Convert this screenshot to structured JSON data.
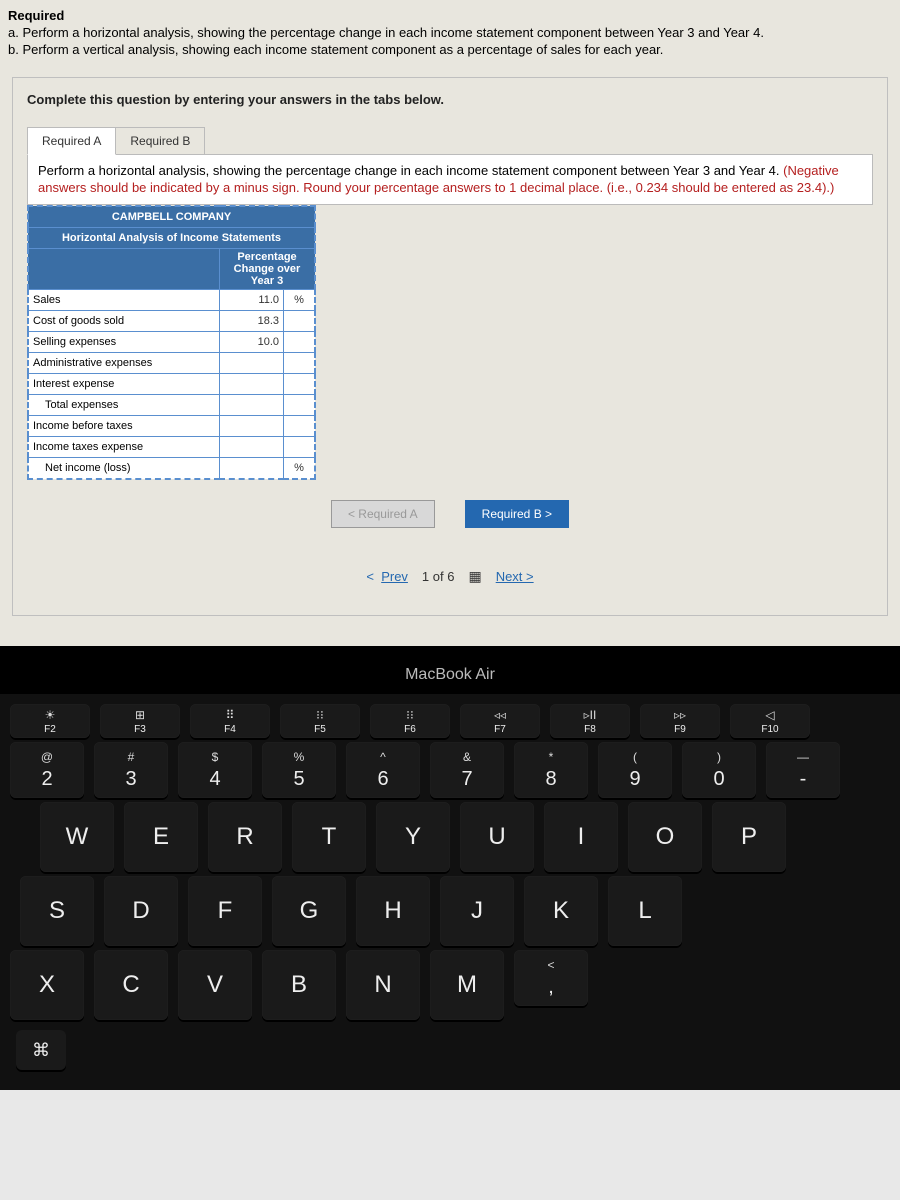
{
  "header": {
    "required_label": "Required",
    "line_a": "a. Perform a horizontal analysis, showing the percentage change in each income statement component between Year 3 and Year 4.",
    "line_b": "b. Perform a vertical analysis, showing each income statement component as a percentage of sales for each year."
  },
  "card": {
    "complete_text": "Complete this question by entering your answers in the tabs below.",
    "tabs": {
      "a": "Required A",
      "b": "Required B"
    },
    "instruction_main": "Perform a horizontal analysis, showing the percentage change in each income statement component between Year 3 and Year 4. ",
    "instruction_red": "(Negative answers should be indicated by a minus sign. Round your percentage answers to 1 decimal place. (i.e., 0.234 should be entered as 23.4).)"
  },
  "table": {
    "company": "CAMPBELL COMPANY",
    "subtitle": "Horizontal Analysis of Income Statements",
    "col_header": "Percentage Change over Year 3",
    "rows": [
      {
        "label": "Sales",
        "value": "11.0",
        "unit": "%",
        "indent": false
      },
      {
        "label": "Cost of goods sold",
        "value": "18.3",
        "unit": "",
        "indent": false
      },
      {
        "label": "Selling expenses",
        "value": "10.0",
        "unit": "",
        "indent": false
      },
      {
        "label": "Administrative expenses",
        "value": "",
        "unit": "",
        "indent": false
      },
      {
        "label": "Interest expense",
        "value": "",
        "unit": "",
        "indent": false
      },
      {
        "label": "Total expenses",
        "value": "",
        "unit": "",
        "indent": true
      },
      {
        "label": "Income before taxes",
        "value": "",
        "unit": "",
        "indent": false
      },
      {
        "label": "Income taxes expense",
        "value": "",
        "unit": "",
        "indent": false
      },
      {
        "label": "Net income (loss)",
        "value": "",
        "unit": "%",
        "indent": true
      }
    ]
  },
  "nav": {
    "prev_tab": "<  Required A",
    "next_tab": "Required B  >"
  },
  "pager": {
    "prev": "Prev",
    "position": "1 of 6",
    "next": "Next  >"
  },
  "laptop": "MacBook Air",
  "fnrow": [
    {
      "icon": "☀",
      "label": "F2"
    },
    {
      "icon": "⊞",
      "label": "F3"
    },
    {
      "icon": "⠿",
      "label": "F4"
    },
    {
      "icon": "⁝⁝",
      "label": "F5"
    },
    {
      "icon": "⁝⁝",
      "label": "F6"
    },
    {
      "icon": "◃◃",
      "label": "F7"
    },
    {
      "icon": "▹II",
      "label": "F8"
    },
    {
      "icon": "▹▹",
      "label": "F9"
    },
    {
      "icon": "◁",
      "label": "F10"
    }
  ],
  "numrow": [
    {
      "u": "@",
      "l": "2"
    },
    {
      "u": "#",
      "l": "3"
    },
    {
      "u": "$",
      "l": "4"
    },
    {
      "u": "%",
      "l": "5"
    },
    {
      "u": "^",
      "l": "6"
    },
    {
      "u": "&",
      "l": "7"
    },
    {
      "u": "*",
      "l": "8"
    },
    {
      "u": "(",
      "l": "9"
    },
    {
      "u": ")",
      "l": "0"
    },
    {
      "u": "—",
      "l": "-"
    }
  ],
  "row_qwerty": [
    "W",
    "E",
    "R",
    "T",
    "Y",
    "U",
    "I",
    "O",
    "P"
  ],
  "row_asdf": [
    "S",
    "D",
    "F",
    "G",
    "H",
    "J",
    "K",
    "L"
  ],
  "row_zxcv": [
    "X",
    "C",
    "V",
    "B",
    "N",
    "M"
  ],
  "bottom_extra": {
    "lt": "<",
    "comma": ","
  },
  "cmd_icon": "⌘"
}
